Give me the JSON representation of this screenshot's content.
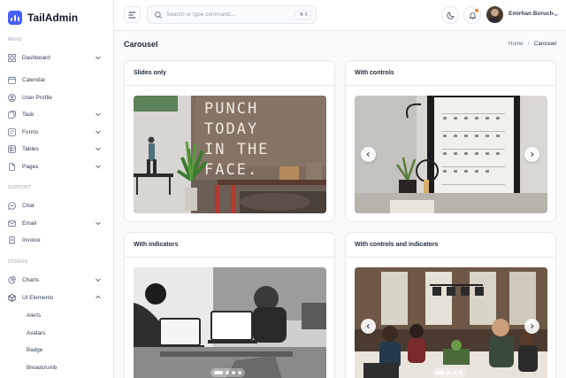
{
  "app": {
    "name": "TailAdmin"
  },
  "sidebar": {
    "sections": {
      "menu": "MENU",
      "support": "SUPPORT",
      "others": "OTHERS"
    },
    "items": [
      {
        "label": "Dashboard",
        "icon": "grid-icon",
        "has_chevron": true
      },
      {
        "label": "Calendar",
        "icon": "calendar-icon"
      },
      {
        "label": "User Profile",
        "icon": "user-circle-icon"
      },
      {
        "label": "Task",
        "icon": "task-icon",
        "has_chevron": true
      },
      {
        "label": "Forms",
        "icon": "forms-icon",
        "has_chevron": true
      },
      {
        "label": "Tables",
        "icon": "table-icon",
        "has_chevron": true
      },
      {
        "label": "Pages",
        "icon": "pages-icon",
        "has_chevron": true
      },
      {
        "label": "Chat",
        "icon": "chat-icon"
      },
      {
        "label": "Email",
        "icon": "mail-icon",
        "has_chevron": true
      },
      {
        "label": "Invoice",
        "icon": "invoice-icon"
      },
      {
        "label": "Charts",
        "icon": "pie-chart-icon",
        "has_chevron": true
      },
      {
        "label": "UI Elements",
        "icon": "box-icon",
        "has_chevron": true,
        "expanded": true
      }
    ],
    "sub_items": [
      "Alerts",
      "Avatars",
      "Badge",
      "Breadcrumb"
    ]
  },
  "header": {
    "search_placeholder": "Search or type command...",
    "search_shortcut": "⌘ K",
    "user_name": "Emirhan Boruch"
  },
  "page": {
    "title": "Carousel",
    "breadcrumb": {
      "home": "Home",
      "separator": "›",
      "current": "Carousel"
    }
  },
  "cards": [
    {
      "title": "Slides only"
    },
    {
      "title": "With controls"
    },
    {
      "title": "With indicators"
    },
    {
      "title": "With controls and indicators"
    }
  ],
  "colors": {
    "accent": "#465fff",
    "notification": "#fd853a",
    "border": "#e4e7ec"
  }
}
